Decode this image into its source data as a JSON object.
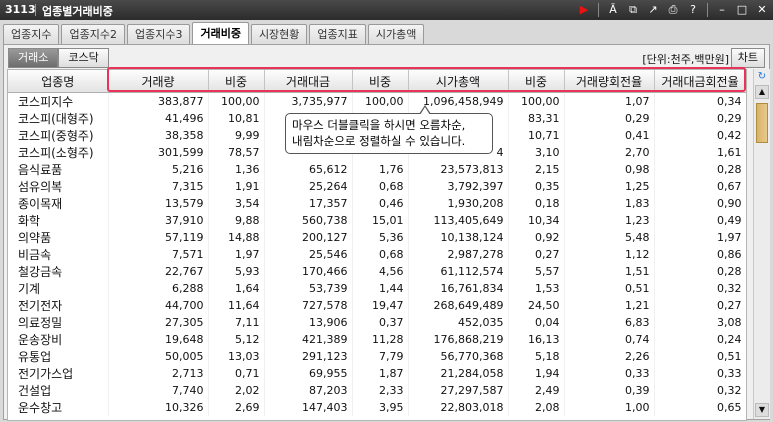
{
  "window": {
    "code": "3113",
    "title": "업종별거래비중"
  },
  "tabs": [
    "업종지수",
    "업종지수2",
    "업종지수3",
    "거래비중",
    "시장현황",
    "업종지표",
    "시가총액"
  ],
  "active_tab": "거래비중",
  "market_buttons": [
    "거래소",
    "코스닥"
  ],
  "unit_text": "[단위:천주,백만원]",
  "chart_label": "차트",
  "columns": [
    "업종명",
    "거래량",
    "비중",
    "거래대금",
    "비중",
    "시가총액",
    "비중",
    "거래량회전율",
    "거래대금회전율"
  ],
  "tooltip": {
    "line1": "마우스 더블클릭을 하시면 오름차순,",
    "line2": "내림차순으로 정렬하실 수 있습니다."
  },
  "rows": [
    [
      "코스피지수",
      "383,877",
      "100,00",
      "3,735,977",
      "100,00",
      "1,096,458,949",
      "100,00",
      "1,07",
      "0,34"
    ],
    [
      "코스피(대형주)",
      "41,496",
      "10,81",
      "",
      "",
      "",
      "83,31",
      "0,29",
      "0,29"
    ],
    [
      "코스피(중형주)",
      "38,358",
      "9,99",
      "",
      "",
      "",
      "10,71",
      "0,41",
      "0,42"
    ],
    [
      "코스피(소형주)",
      "301,599",
      "78,57",
      "",
      "",
      "4",
      "3,10",
      "2,70",
      "1,61"
    ],
    [
      "음식료품",
      "5,216",
      "1,36",
      "65,612",
      "1,76",
      "23,573,813",
      "2,15",
      "0,98",
      "0,28"
    ],
    [
      "섬유의복",
      "7,315",
      "1,91",
      "25,264",
      "0,68",
      "3,792,397",
      "0,35",
      "1,25",
      "0,67"
    ],
    [
      "종이목재",
      "13,579",
      "3,54",
      "17,357",
      "0,46",
      "1,930,208",
      "0,18",
      "1,83",
      "0,90"
    ],
    [
      "화학",
      "37,910",
      "9,88",
      "560,738",
      "15,01",
      "113,405,649",
      "10,34",
      "1,23",
      "0,49"
    ],
    [
      "의약품",
      "57,119",
      "14,88",
      "200,127",
      "5,36",
      "10,138,124",
      "0,92",
      "5,48",
      "1,97"
    ],
    [
      "비금속",
      "7,571",
      "1,97",
      "25,546",
      "0,68",
      "2,987,278",
      "0,27",
      "1,12",
      "0,86"
    ],
    [
      "철강금속",
      "22,767",
      "5,93",
      "170,466",
      "4,56",
      "61,112,574",
      "5,57",
      "1,51",
      "0,28"
    ],
    [
      "기계",
      "6,288",
      "1,64",
      "53,739",
      "1,44",
      "16,761,834",
      "1,53",
      "0,51",
      "0,32"
    ],
    [
      "전기전자",
      "44,700",
      "11,64",
      "727,578",
      "19,47",
      "268,649,489",
      "24,50",
      "1,21",
      "0,27"
    ],
    [
      "의료정밀",
      "27,305",
      "7,11",
      "13,906",
      "0,37",
      "452,035",
      "0,04",
      "6,83",
      "3,08"
    ],
    [
      "운송장비",
      "19,648",
      "5,12",
      "421,389",
      "11,28",
      "176,868,219",
      "16,13",
      "0,74",
      "0,24"
    ],
    [
      "유통업",
      "50,005",
      "13,03",
      "291,123",
      "7,79",
      "56,770,368",
      "5,18",
      "2,26",
      "0,51"
    ],
    [
      "전기가스업",
      "2,713",
      "0,71",
      "69,955",
      "1,87",
      "21,284,058",
      "1,94",
      "0,33",
      "0,33"
    ],
    [
      "건설업",
      "7,740",
      "2,02",
      "87,203",
      "2,33",
      "27,297,587",
      "2,49",
      "0,39",
      "0,32"
    ],
    [
      "운수창고",
      "10,326",
      "2,69",
      "147,403",
      "3,95",
      "22,803,018",
      "2,08",
      "1,00",
      "0,65"
    ]
  ]
}
